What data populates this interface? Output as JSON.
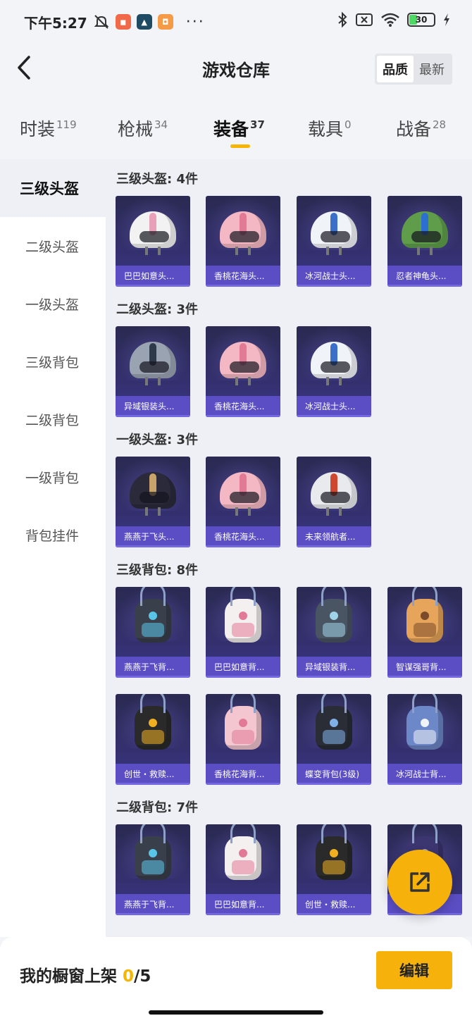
{
  "status_bar": {
    "time": "下午5:27",
    "battery": "30",
    "app_icons": [
      "red-app-icon",
      "game-app-icon",
      "orange-app-icon"
    ],
    "dots": "···"
  },
  "header": {
    "title": "游戏仓库",
    "sort_options": [
      "品质",
      "最新"
    ],
    "sort_active": "品质"
  },
  "tabs": [
    {
      "label": "时装",
      "count": "119"
    },
    {
      "label": "枪械",
      "count": "34"
    },
    {
      "label": "装备",
      "count": "37",
      "active": true
    },
    {
      "label": "载具",
      "count": "0"
    },
    {
      "label": "战备",
      "count": "28"
    }
  ],
  "sidebar": {
    "items": [
      "三级头盔",
      "二级头盔",
      "一级头盔",
      "三级背包",
      "二级背包",
      "一级背包",
      "背包挂件"
    ],
    "active": "三级头盔"
  },
  "sections": [
    {
      "title": "三级头盔: 4件",
      "items": [
        {
          "label": "巴巴如意头...",
          "kind": "helmet",
          "color": "#f2f2f2",
          "accent": "#e8a0b8"
        },
        {
          "label": "香桃花海头...",
          "kind": "helmet",
          "color": "#f4b8c4",
          "accent": "#e27a97"
        },
        {
          "label": "冰河战士头...",
          "kind": "helmet",
          "color": "#f0f3f8",
          "accent": "#3b6fc9"
        },
        {
          "label": "忍者神龟头...",
          "kind": "helmet",
          "color": "#5f9d4a",
          "accent": "#2d6fd0"
        }
      ]
    },
    {
      "title": "二级头盔: 3件",
      "items": [
        {
          "label": "异域银装头...",
          "kind": "helmet",
          "color": "#9aa3b2",
          "accent": "#2e3a4a"
        },
        {
          "label": "香桃花海头...",
          "kind": "helmet",
          "color": "#f4b8c4",
          "accent": "#e27a97"
        },
        {
          "label": "冰河战士头...",
          "kind": "helmet",
          "color": "#f0f3f8",
          "accent": "#3b6fc9"
        }
      ]
    },
    {
      "title": "一级头盔: 3件",
      "items": [
        {
          "label": "燕燕于飞头...",
          "kind": "helmet",
          "color": "#2b2a3a",
          "accent": "#c9a46a"
        },
        {
          "label": "香桃花海头...",
          "kind": "helmet",
          "color": "#f4b8c4",
          "accent": "#e27a97"
        },
        {
          "label": "未来领航者...",
          "kind": "helmet",
          "color": "#e9eaee",
          "accent": "#d0472f"
        }
      ]
    },
    {
      "title": "三级背包: 8件",
      "items": [
        {
          "label": "燕燕于飞背...",
          "kind": "pack",
          "color": "#3a3f4c",
          "accent": "#58c6e8"
        },
        {
          "label": "巴巴如意背...",
          "kind": "pack",
          "color": "#f5f0f0",
          "accent": "#e27a97"
        },
        {
          "label": "异域银装背...",
          "kind": "pack",
          "color": "#4a5563",
          "accent": "#9fd3e8"
        },
        {
          "label": "智谋强哥背...",
          "kind": "pack",
          "color": "#e6a55a",
          "accent": "#7a4a2a"
        },
        {
          "label": "创世・救赎...",
          "kind": "pack",
          "color": "#2a2a2a",
          "accent": "#f0b020"
        },
        {
          "label": "香桃花海背...",
          "kind": "pack",
          "color": "#f4c6d0",
          "accent": "#e27a97"
        },
        {
          "label": "蝶变背包(3级)",
          "kind": "pack",
          "color": "#2a2d36",
          "accent": "#7fb0e8"
        },
        {
          "label": "冰河战士背...",
          "kind": "pack",
          "color": "#6d88c8",
          "accent": "#f0f3f8"
        }
      ]
    },
    {
      "title": "二级背包: 7件",
      "items": [
        {
          "label": "燕燕于飞背...",
          "kind": "pack",
          "color": "#3a3f4c",
          "accent": "#58c6e8"
        },
        {
          "label": "巴巴如意背...",
          "kind": "pack",
          "color": "#f5f0f0",
          "accent": "#e27a97"
        },
        {
          "label": "创世・救赎...",
          "kind": "pack",
          "color": "#2a2a2a",
          "accent": "#f0b020"
        },
        {
          "label": "",
          "kind": "pack",
          "color": "#3b3570",
          "accent": "#8fa0c8"
        }
      ]
    }
  ],
  "bottom_bar": {
    "shelf_label": "我的橱窗上架",
    "shelf_current": "0",
    "shelf_total": "/5",
    "edit_label": "编辑"
  }
}
